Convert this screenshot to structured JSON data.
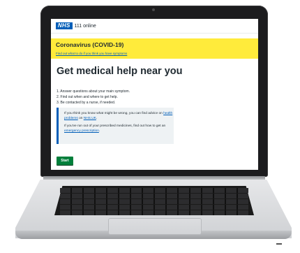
{
  "header": {
    "logo": "NHS",
    "service_name": "111 online"
  },
  "banner": {
    "title": "Coronavirus (COVID-19)",
    "link": "Find out what to do if you think you have symptoms"
  },
  "main": {
    "heading": "Get medical help near you",
    "steps": [
      "1. Answer questions about your main symptom.",
      "2. Find out when and where to get help.",
      "3. Be contacted by a nurse, if needed."
    ],
    "inset": {
      "p1_before": "If you think you know what might be wrong, you can find advice on ",
      "p1_link1": "health problems",
      "p1_mid": " on ",
      "p1_link2": "NHS.UK",
      "p1_after": ".",
      "p2_before": "If you've run out of your prescribed medicines, find out how to get an ",
      "p2_link": "emergency prescription",
      "p2_after": "."
    },
    "start_label": "Start"
  },
  "colors": {
    "nhs_blue": "#005eb8",
    "banner_yellow": "#ffeb3b",
    "start_green": "#007f3b"
  }
}
